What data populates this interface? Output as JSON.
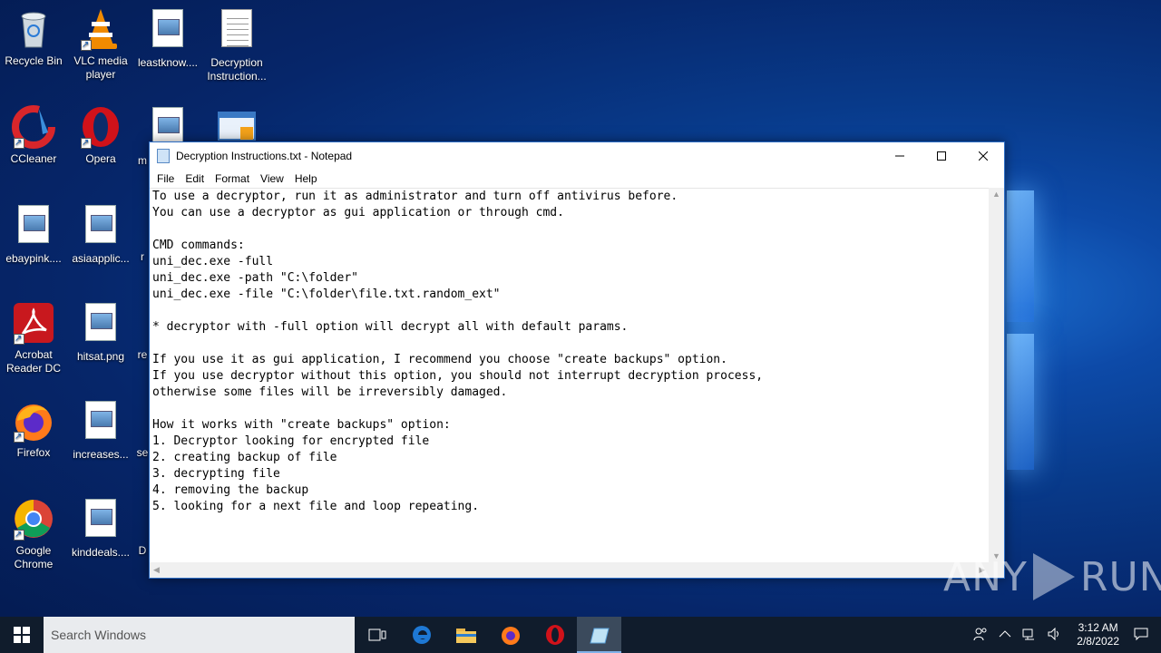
{
  "desktop": {
    "icons": [
      {
        "label": "Recycle Bin"
      },
      {
        "label": "VLC media player"
      },
      {
        "label": "leastknow...."
      },
      {
        "label": "Decryption Instruction..."
      },
      {
        "label": "CCleaner"
      },
      {
        "label": "Opera"
      },
      {
        "label": "m"
      },
      {
        "label": "ebaypink...."
      },
      {
        "label": "asiaapplic..."
      },
      {
        "label": "r"
      },
      {
        "label": "Acrobat Reader DC"
      },
      {
        "label": "hitsat.png"
      },
      {
        "label": "re"
      },
      {
        "label": "Firefox"
      },
      {
        "label": "increases..."
      },
      {
        "label": "se"
      },
      {
        "label": "Google Chrome"
      },
      {
        "label": "kinddeals...."
      },
      {
        "label": "D"
      }
    ]
  },
  "notepad": {
    "title": "Decryption Instructions.txt - Notepad",
    "menu": [
      "File",
      "Edit",
      "Format",
      "View",
      "Help"
    ],
    "content": "To use a decryptor, run it as administrator and turn off antivirus before.\nYou can use a decryptor as gui application or through cmd.\n\nCMD commands:\nuni_dec.exe -full\nuni_dec.exe -path \"C:\\folder\"\nuni_dec.exe -file \"C:\\folder\\file.txt.random_ext\"\n\n* decryptor with -full option will decrypt all with default params.\n\nIf you use it as gui application, I recommend you choose \"create backups\" option.\nIf you use decryptor without this option, you should not interrupt decryption process,\notherwise some files will be irreversibly damaged.\n\nHow it works with \"create backups\" option:\n1. Decryptor looking for encrypted file\n2. creating backup of file\n3. decrypting file\n4. removing the backup\n5. looking for a next file and loop repeating."
  },
  "watermark": {
    "left": "ANY",
    "right": "RUN"
  },
  "taskbar": {
    "search_placeholder": "Search Windows",
    "clock_time": "3:12 AM",
    "clock_date": "2/8/2022"
  }
}
